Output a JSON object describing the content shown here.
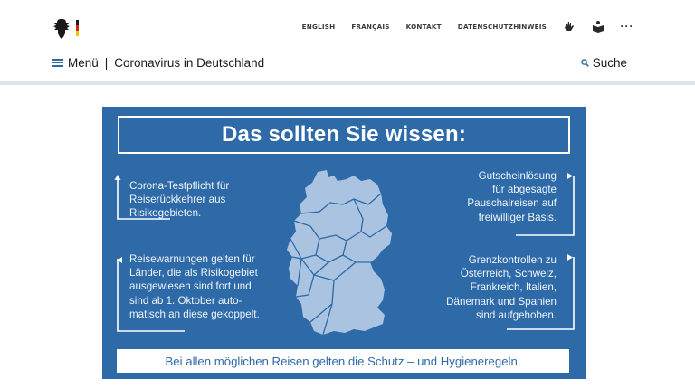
{
  "header": {
    "nav_links": [
      "ENGLISH",
      "FRANÇAIS",
      "KONTAKT",
      "DATENSCHUTZHINWEIS"
    ],
    "icons": [
      "sign-language-icon",
      "easy-language-icon",
      "more-icon"
    ],
    "more_label": "···",
    "menu_label": "Menü",
    "separator": "|",
    "site_title": "Coronavirus in Deutschland",
    "search_label": "Suche"
  },
  "infographic": {
    "title": "Das sollten Sie wissen:",
    "left_top": "Corona-Testpflicht für Reiserückkehrer aus Risikogebieten.",
    "left_bottom": "Reisewarnungen gelten für Länder, die als Risikogebiet ausgewiesen sind fort und sind ab 1. Oktober automatisch an diese gekoppelt.",
    "left_bottom_lines": [
      "Reisewarnungen gelten für",
      "Länder, die als Risikogebiet",
      "ausgewiesen sind fort und",
      "sind ab 1. Oktober auto-",
      "matisch an diese gekoppelt."
    ],
    "right_top_lines": [
      "Gutscheinlösung",
      "für abgesagte",
      "Pauschalreisen auf",
      "freiwilliger Basis."
    ],
    "right_bottom_lines": [
      "Grenzkontrollen zu",
      "Österreich, Schweiz,",
      "Frankreich, Italien,",
      "Dänemark und Spanien",
      "sind aufgehoben."
    ],
    "left_top_lines": [
      "Corona-Testpflicht für",
      "Reiserückkehrer aus",
      "Risikogebieten."
    ],
    "map_icon": "germany-map-icon",
    "footer": "Bei allen möglichen Reisen gelten die Schutz – und Hygieneregeln.",
    "colors": {
      "background": "#2f6aa8",
      "map": "#a9c3e0",
      "text": "#ffffff"
    }
  }
}
